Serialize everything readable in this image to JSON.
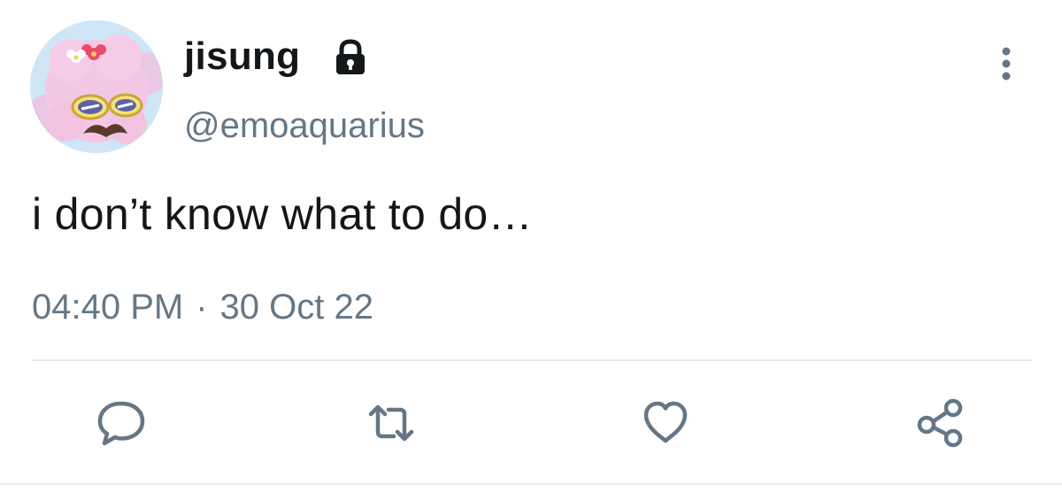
{
  "tweet": {
    "author": {
      "display_name": "jisung",
      "handle": "@emoaquarius",
      "protected_icon": "lock-icon",
      "avatar_icon": "pink-sheep-avatar"
    },
    "text": "i don’t know what to do…",
    "time": "04:40 PM",
    "separator": "·",
    "date": "30 Oct 22",
    "menu_icon": "more-vertical-icon"
  },
  "actions": [
    {
      "name": "reply",
      "icon": "comment-bubble-icon"
    },
    {
      "name": "retweet",
      "icon": "retweet-arrows-icon"
    },
    {
      "name": "like",
      "icon": "heart-icon"
    },
    {
      "name": "share",
      "icon": "share-nodes-icon"
    }
  ],
  "colors": {
    "text_primary": "#14171a",
    "text_secondary": "#657786",
    "icon": "#657786",
    "divider": "#e6ecf0"
  }
}
